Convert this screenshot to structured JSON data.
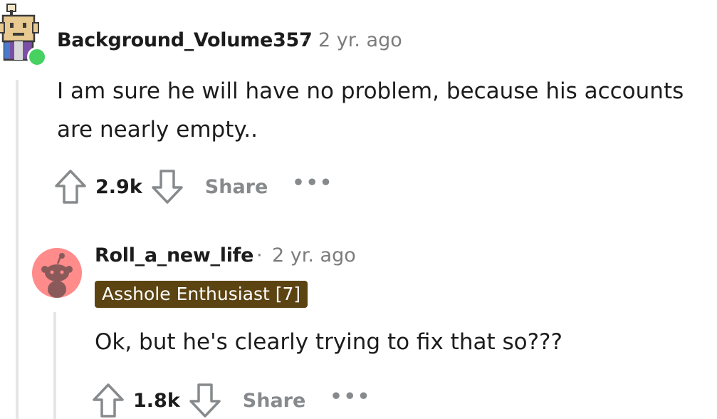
{
  "comments": [
    {
      "username": "Background_Volume357",
      "separator": "·",
      "time": "2 yr. ago",
      "body_lines": [
        "I am sure he will have no problem, because his accounts",
        "are nearly empty.."
      ],
      "votes": "2.9k",
      "share_label": "Share",
      "more_label": "•••",
      "online": true
    },
    {
      "username": "Roll_a_new_life",
      "separator": "·",
      "time": "2 yr. ago",
      "flair": "Asshole Enthusiast [7]",
      "body_lines": [
        "Ok, but he's clearly trying to fix that so???"
      ],
      "votes": "1.8k",
      "share_label": "Share",
      "more_label": "•••"
    }
  ],
  "icons": {
    "upvote": "upvote-arrow-icon",
    "downvote": "downvote-arrow-icon",
    "avatar1": "robot-avatar-icon",
    "avatar2": "snoo-avatar-icon",
    "online": "online-status-icon"
  },
  "colors": {
    "flair_bg": "#5c4412",
    "avatar2_bg": "#ff8b8b",
    "online_dot": "#46d160",
    "muted": "#7c7c7c"
  }
}
